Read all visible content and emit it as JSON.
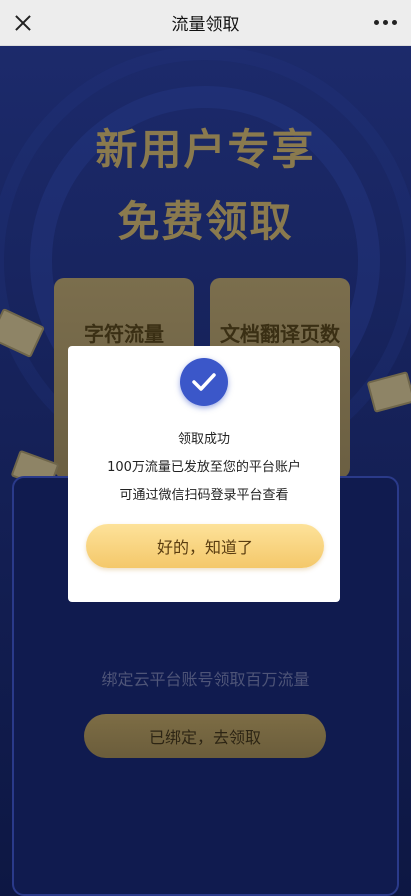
{
  "navbar": {
    "title": "流量领取"
  },
  "hero": {
    "line1": "新用户专享",
    "line2": "免费领取"
  },
  "cards": [
    {
      "label": "字符流量"
    },
    {
      "label": "文档翻译页数"
    }
  ],
  "bind": {
    "text": "绑定云平台账号领取百万流量",
    "button_label": "已绑定，去领取"
  },
  "dialog": {
    "title": "领取成功",
    "line1": "100万流量已发放至您的平台账户",
    "line2": "可通过微信扫码登录平台查看",
    "ok_label": "好的，知道了",
    "accent_color": "#3b57c9"
  }
}
